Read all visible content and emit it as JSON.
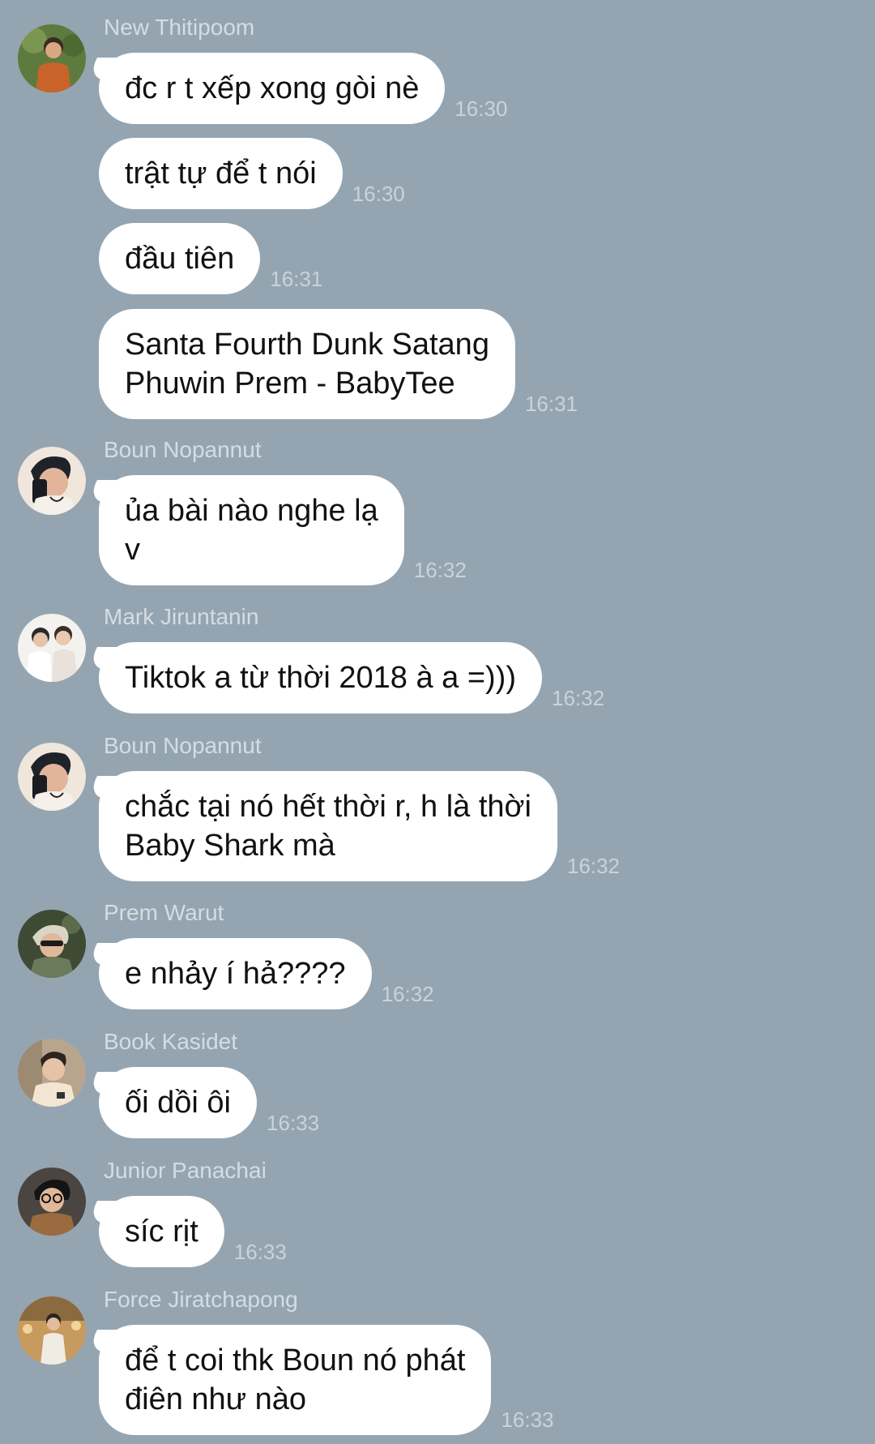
{
  "messages": [
    {
      "sender": "New Thitipoom",
      "avatar_icon": "avatar-new-thitipoom",
      "items": [
        {
          "text": "đc r t xếp xong gòi nè",
          "time": "16:30"
        },
        {
          "text": "trật tự để t nói",
          "time": "16:30"
        },
        {
          "text": "đầu tiên",
          "time": "16:31"
        },
        {
          "text": "Santa Fourth Dunk Satang\nPhuwin Prem - BabyTee",
          "time": "16:31"
        }
      ]
    },
    {
      "sender": "Boun Nopannut",
      "avatar_icon": "avatar-boun-nopannut",
      "items": [
        {
          "text": "ủa bài nào nghe lạ\nv",
          "time": "16:32"
        }
      ]
    },
    {
      "sender": "Mark Jiruntanin",
      "avatar_icon": "avatar-mark-jiruntanin",
      "items": [
        {
          "text": "Tiktok a từ thời 2018 à a =)))",
          "time": "16:32"
        }
      ]
    },
    {
      "sender": "Boun Nopannut",
      "avatar_icon": "avatar-boun-nopannut",
      "items": [
        {
          "text": "chắc tại nó hết thời r, h là thời\nBaby Shark mà",
          "time": "16:32"
        }
      ]
    },
    {
      "sender": "Prem Warut",
      "avatar_icon": "avatar-prem-warut",
      "items": [
        {
          "text": "e nhảy í hả????",
          "time": "16:32"
        }
      ]
    },
    {
      "sender": "Book Kasidet",
      "avatar_icon": "avatar-book-kasidet",
      "items": [
        {
          "text": "ối dồi ôi",
          "time": "16:33"
        }
      ]
    },
    {
      "sender": "Junior Panachai",
      "avatar_icon": "avatar-junior-panachai",
      "items": [
        {
          "text": "síc rịt",
          "time": "16:33"
        }
      ]
    },
    {
      "sender": "Force Jiratchapong",
      "avatar_icon": "avatar-force-jiratchapong",
      "items": [
        {
          "text": "để t coi thk Boun nó phát\nđiên như nào",
          "time": "16:33"
        }
      ]
    }
  ],
  "colors": {
    "background": "#94a5b1",
    "bubble": "#ffffff",
    "sender_name": "#d4dde3",
    "timestamp": "#c9d3da"
  }
}
